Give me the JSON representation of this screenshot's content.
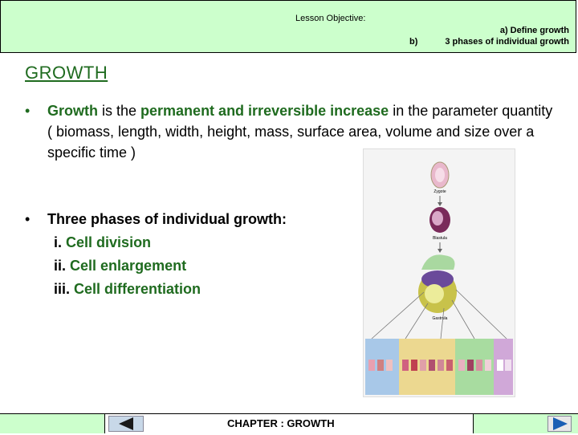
{
  "header": {
    "objective_label": "Lesson Objective:",
    "objective_link": " ",
    "item_a": "a)   Define growth",
    "item_b_marker": "b)",
    "item_b": "3  phases of individual growth"
  },
  "slide": {
    "title": "GROWTH",
    "bullet1": {
      "bullet": "•",
      "term": "Growth",
      "text1": " is the ",
      "emphasis": "permanent and irreversible increase",
      "text2": " in the parameter quantity ( biomass, length, width, height, mass, surface area, volume and size over a specific time )"
    },
    "bullet2": {
      "bullet": "•",
      "heading": "Three phases of individual growth:",
      "phases": [
        {
          "num": "i.",
          "label": "Cell division"
        },
        {
          "num": "ii.",
          "label": "Cell enlargement"
        },
        {
          "num": "iii.",
          "label": "Cell differentiation"
        }
      ]
    }
  },
  "figure": {
    "labels": [
      "Zygote",
      "Blastula",
      "Gastrula"
    ]
  },
  "footer": {
    "chapter": "CHAPTER : GROWTH"
  },
  "colors": {
    "header_bg": "#ccffcc",
    "title_green": "#1f6b1f",
    "accent_light_green": "#3d9a3d"
  }
}
